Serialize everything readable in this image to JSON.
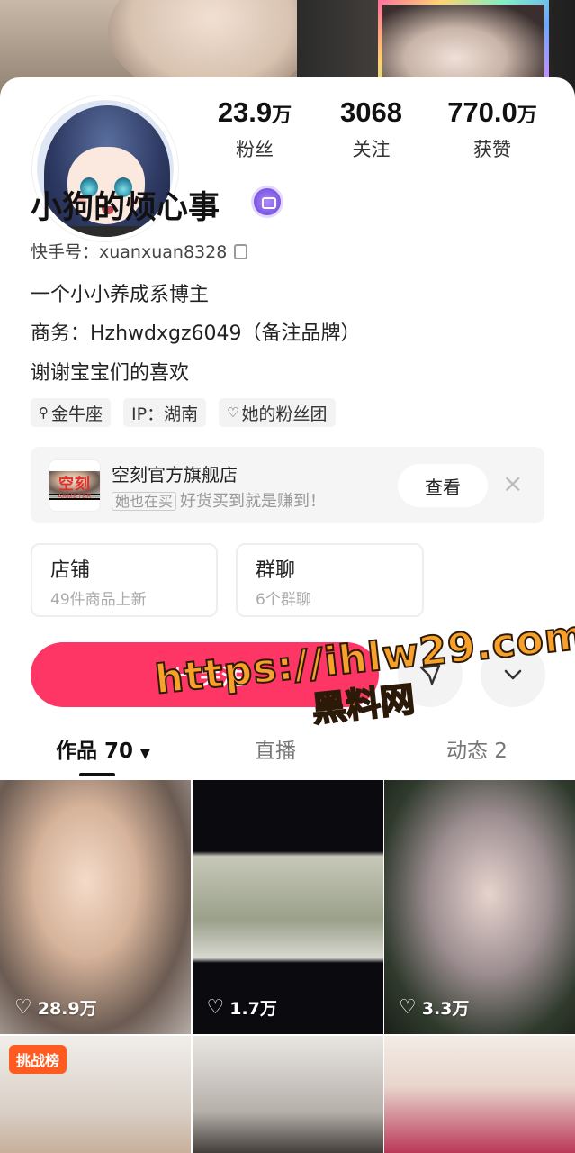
{
  "profile": {
    "name": "小狗的烦心事",
    "kwai_id": "快手号：xuanxuan8328",
    "bio": [
      "一个小小养成系博主",
      "商务：Hzhwdxgz6049（备注品牌）",
      "谢谢宝宝们的喜欢"
    ]
  },
  "stats": [
    {
      "value": "23.9",
      "unit": "万",
      "label": "粉丝"
    },
    {
      "value": "3068",
      "unit": "",
      "label": "关注"
    },
    {
      "value": "770.0",
      "unit": "万",
      "label": "获赞"
    }
  ],
  "tags": [
    "金牛座",
    "IP：湖南",
    "她的粉丝团"
  ],
  "shop_card": {
    "logo_text": "空刻",
    "logo_sub": "ARMETER",
    "title": "空刻官方旗舰店",
    "chip": "她也在买",
    "subtitle": "好货买到就是赚到！",
    "view_label": "查看",
    "close_icon": "×"
  },
  "boxes": [
    {
      "title": "店铺",
      "subtitle": "49件商品上新"
    },
    {
      "title": "群聊",
      "subtitle": "6个群聊"
    }
  ],
  "follow_button": {
    "icon": "+",
    "label": "关注"
  },
  "tabs": [
    {
      "label": "作品 70",
      "active": true
    },
    {
      "label": "直播",
      "active": false
    },
    {
      "label": "动态 2",
      "active": false
    }
  ],
  "watermark": {
    "line1": "https://ihlw29.com",
    "line2": "黑料网"
  },
  "videos": [
    {
      "likes": "28.9万"
    },
    {
      "likes": "1.7万"
    },
    {
      "likes": "3.3万"
    },
    {
      "badge": "挑战榜"
    }
  ],
  "colors": {
    "accent": "#fe3666",
    "challenge": "#ff5a1f",
    "verified": "#7a57e0"
  }
}
